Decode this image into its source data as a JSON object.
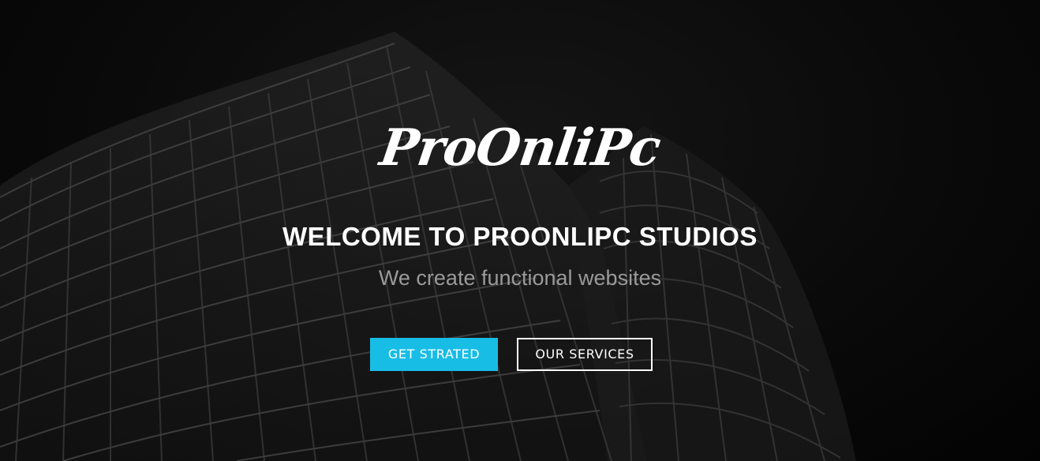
{
  "hero": {
    "logo_text": "ProOnliPc",
    "headline": "WELCOME TO PROONLIPC STUDIOS",
    "tagline": "We create functional websites",
    "primary_button_label": "GET STRATED",
    "secondary_button_label": "OUR SERVICES"
  },
  "colors": {
    "primary_accent": "#18bde6",
    "text": "#ffffff",
    "tagline": "#9a9a9a",
    "background": "#050505"
  }
}
